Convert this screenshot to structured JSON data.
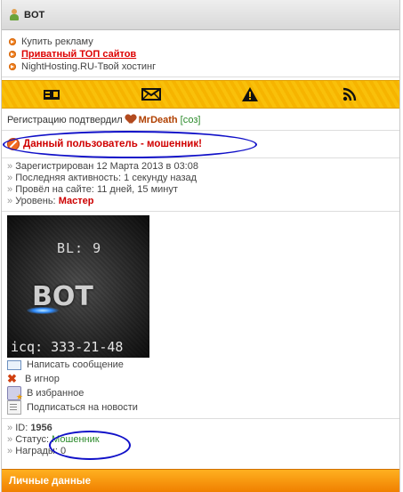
{
  "window": {
    "title": "BOT"
  },
  "ads": [
    {
      "label": "Купить рекламу",
      "style": "normal"
    },
    {
      "label": "Приватный ТОП сайтов",
      "style": "red"
    },
    {
      "label": "NightHosting.RU-Твой хостинг",
      "style": "normal"
    }
  ],
  "toolbar": {
    "icons": [
      "contact-card-icon",
      "envelope-icon",
      "warning-icon",
      "rss-icon"
    ],
    "accent": "#f6b400"
  },
  "registration": {
    "prefix": "Регистрацию подтвердил",
    "confirmer": "MrDeath",
    "tag": "[соз]"
  },
  "warning": {
    "text": "Данный пользователь - мошенник!",
    "color": "#d00000"
  },
  "stats": [
    {
      "label": "Зарегистрирован",
      "value": "12 Марта 2013 в 03:08"
    },
    {
      "label": "Последняя активность:",
      "value": "1 секунду назад"
    },
    {
      "label": "Провёл на сайте:",
      "value": "11 дней, 15 минут"
    },
    {
      "label": "Уровень:",
      "value": "Мастер"
    }
  ],
  "avatar": {
    "bl_text": "BL: 9",
    "name_text": "BOT",
    "icq_text": "icq: 333-21-48"
  },
  "actions": [
    {
      "icon": "envelope-icon",
      "label": "Написать сообщение"
    },
    {
      "icon": "ignore-icon",
      "label": "В игнор"
    },
    {
      "icon": "favorite-icon",
      "label": "В избранное"
    },
    {
      "icon": "news-icon",
      "label": "Подписаться на новости"
    }
  ],
  "info": {
    "id_label": "ID:",
    "id_value": "1956",
    "status_label": "Статус:",
    "status_value": "Мошенник",
    "awards_label": "Награды:",
    "awards_value": "0"
  },
  "footer": {
    "title": "Личные данные"
  }
}
